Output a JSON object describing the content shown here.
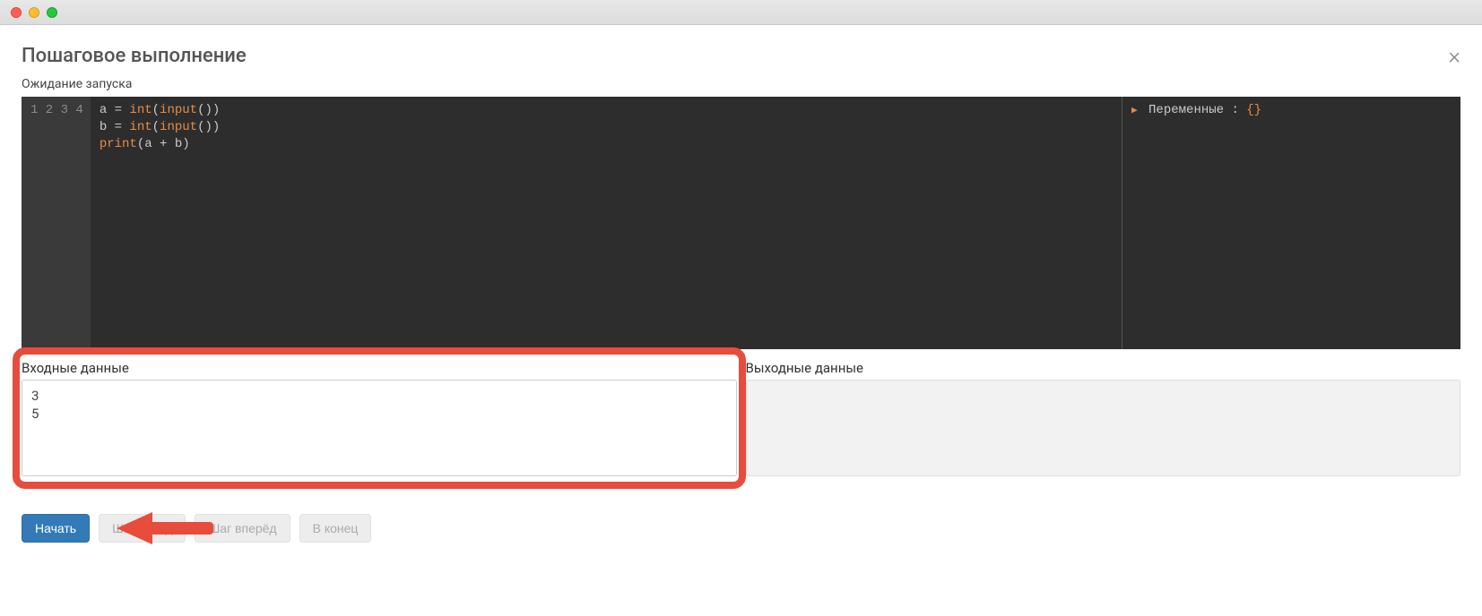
{
  "window": {},
  "modal": {
    "title": "Пошаговое выполнение",
    "status": "Ожидание запуска"
  },
  "code": {
    "line_numbers": [
      "1",
      "2",
      "3",
      "4"
    ],
    "lines_raw": [
      "a = int(input())",
      "b = int(input())",
      "print(a + b)",
      ""
    ]
  },
  "vars_panel": {
    "label": "Переменные",
    "sep": " : ",
    "value": "{}"
  },
  "io": {
    "input_label": "Входные данные",
    "input_value": "3\n5",
    "output_label": "Выходные данные",
    "output_value": ""
  },
  "buttons": {
    "start": "Начать",
    "back": "Шаг назад",
    "forward": "Шаг вперёд",
    "end": "В конец"
  }
}
